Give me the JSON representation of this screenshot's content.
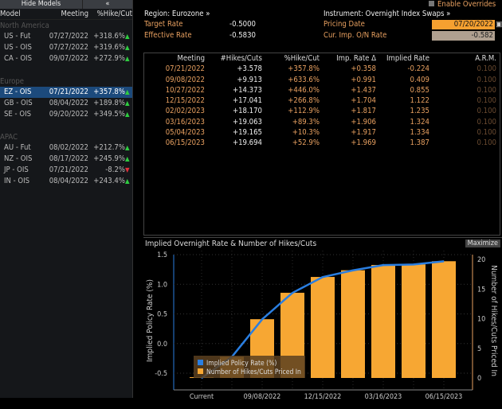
{
  "left": {
    "hide_models": "Hide Models",
    "collapse": "«",
    "cols": [
      "Model",
      "Meeting",
      "%Hike/Cut"
    ],
    "groups": [
      {
        "name": "North America",
        "rows": [
          [
            "US - Fut",
            "07/27/2022",
            "+318.6%",
            "up"
          ],
          [
            "US - OIS",
            "07/27/2022",
            "+319.6%",
            "up"
          ],
          [
            "CA - OIS",
            "09/07/2022",
            "+272.9%",
            "up"
          ]
        ]
      },
      {
        "name": "Europe",
        "rows": [
          [
            "EZ - OIS",
            "07/21/2022",
            "+357.8%",
            "up"
          ],
          [
            "GB - OIS",
            "08/04/2022",
            "+189.8%",
            "up"
          ],
          [
            "SE - OIS",
            "09/20/2022",
            "+349.5%",
            "up"
          ]
        ]
      },
      {
        "name": "APAC",
        "rows": [
          [
            "AU - Fut",
            "08/02/2022",
            "+212.7%",
            "up"
          ],
          [
            "NZ - OIS",
            "08/17/2022",
            "+245.9%",
            "up"
          ],
          [
            "JP - OIS",
            "07/21/2022",
            "-8.2%",
            "down"
          ],
          [
            "IN - OIS",
            "08/04/2022",
            "+243.4%",
            "up"
          ]
        ]
      }
    ],
    "selected": "EZ - OIS"
  },
  "header": {
    "enable_overrides": "Enable Overrides",
    "region": "Region: Eurozone »",
    "target_rate_label": "Target Rate",
    "target_rate": "-0.5000",
    "effective_rate_label": "Effective Rate",
    "effective_rate": "-0.5830",
    "instrument": "Instrument: Overnight Index Swaps »",
    "pricing_date_label": "Pricing Date",
    "pricing_date": "07/20/2022",
    "cur_imp_label": "Cur. Imp. O/N Rate",
    "cur_imp": "-0.582"
  },
  "table": {
    "headers": [
      "Meeting",
      "#Hikes/Cuts",
      "%Hike/Cut",
      "Imp. Rate Δ",
      "Implied Rate",
      "A.R.M."
    ],
    "rows": [
      [
        "07/21/2022",
        "+3.578",
        "+357.8%",
        "+0.358",
        "-0.224",
        "0.100"
      ],
      [
        "09/08/2022",
        "+9.913",
        "+633.6%",
        "+0.991",
        "0.409",
        "0.100"
      ],
      [
        "10/27/2022",
        "+14.373",
        "+446.0%",
        "+1.437",
        "0.855",
        "0.100"
      ],
      [
        "12/15/2022",
        "+17.041",
        "+266.8%",
        "+1.704",
        "1.122",
        "0.100"
      ],
      [
        "02/02/2023",
        "+18.170",
        "+112.9%",
        "+1.817",
        "1.235",
        "0.100"
      ],
      [
        "03/16/2023",
        "+19.063",
        "+89.3%",
        "+1.906",
        "1.324",
        "0.100"
      ],
      [
        "05/04/2023",
        "+19.165",
        "+10.3%",
        "+1.917",
        "1.334",
        "0.100"
      ],
      [
        "06/15/2023",
        "+19.694",
        "+52.9%",
        "+1.969",
        "1.387",
        "0.100"
      ]
    ]
  },
  "chart_title": "Implied Overnight Rate & Number of Hikes/Cuts",
  "maximize": "Maximize",
  "colors": {
    "bar": "#f7a733",
    "line": "#2a7ee0",
    "accent": "#e8a060"
  },
  "chart_data": {
    "type": "bar+line",
    "categories": [
      "Current",
      "07/21/2022",
      "09/08/2022",
      "10/27/2022",
      "12/15/2022",
      "02/02/2023",
      "03/16/2023",
      "05/04/2023",
      "06/15/2023"
    ],
    "x_tick_labels": [
      "Current",
      "09/08/2022",
      "12/15/2022",
      "03/16/2023",
      "06/15/2023"
    ],
    "series": [
      {
        "name": "Implied Policy Rate (%)",
        "type": "line",
        "axis": "left",
        "values": [
          -0.582,
          -0.224,
          0.409,
          0.855,
          1.122,
          1.235,
          1.324,
          1.334,
          1.387
        ]
      },
      {
        "name": "Number of Hikes/Cuts Priced In",
        "type": "bar",
        "axis": "right",
        "values": [
          0,
          3.578,
          9.913,
          14.373,
          17.041,
          18.17,
          19.063,
          19.165,
          19.694
        ]
      }
    ],
    "ylabel": "Implied Policy Rate (%)",
    "y2label": "Number of Hikes/Cuts Priced In",
    "ylim": [
      -0.75,
      1.6
    ],
    "yticks": [
      "1.5",
      "1.0",
      "0.5",
      "0.0",
      "-0.5"
    ],
    "y2lim": [
      -2,
      21
    ],
    "y2ticks": [
      "20",
      "15",
      "10",
      "5",
      "0"
    ],
    "grid": true,
    "legend": "bottom-left"
  }
}
